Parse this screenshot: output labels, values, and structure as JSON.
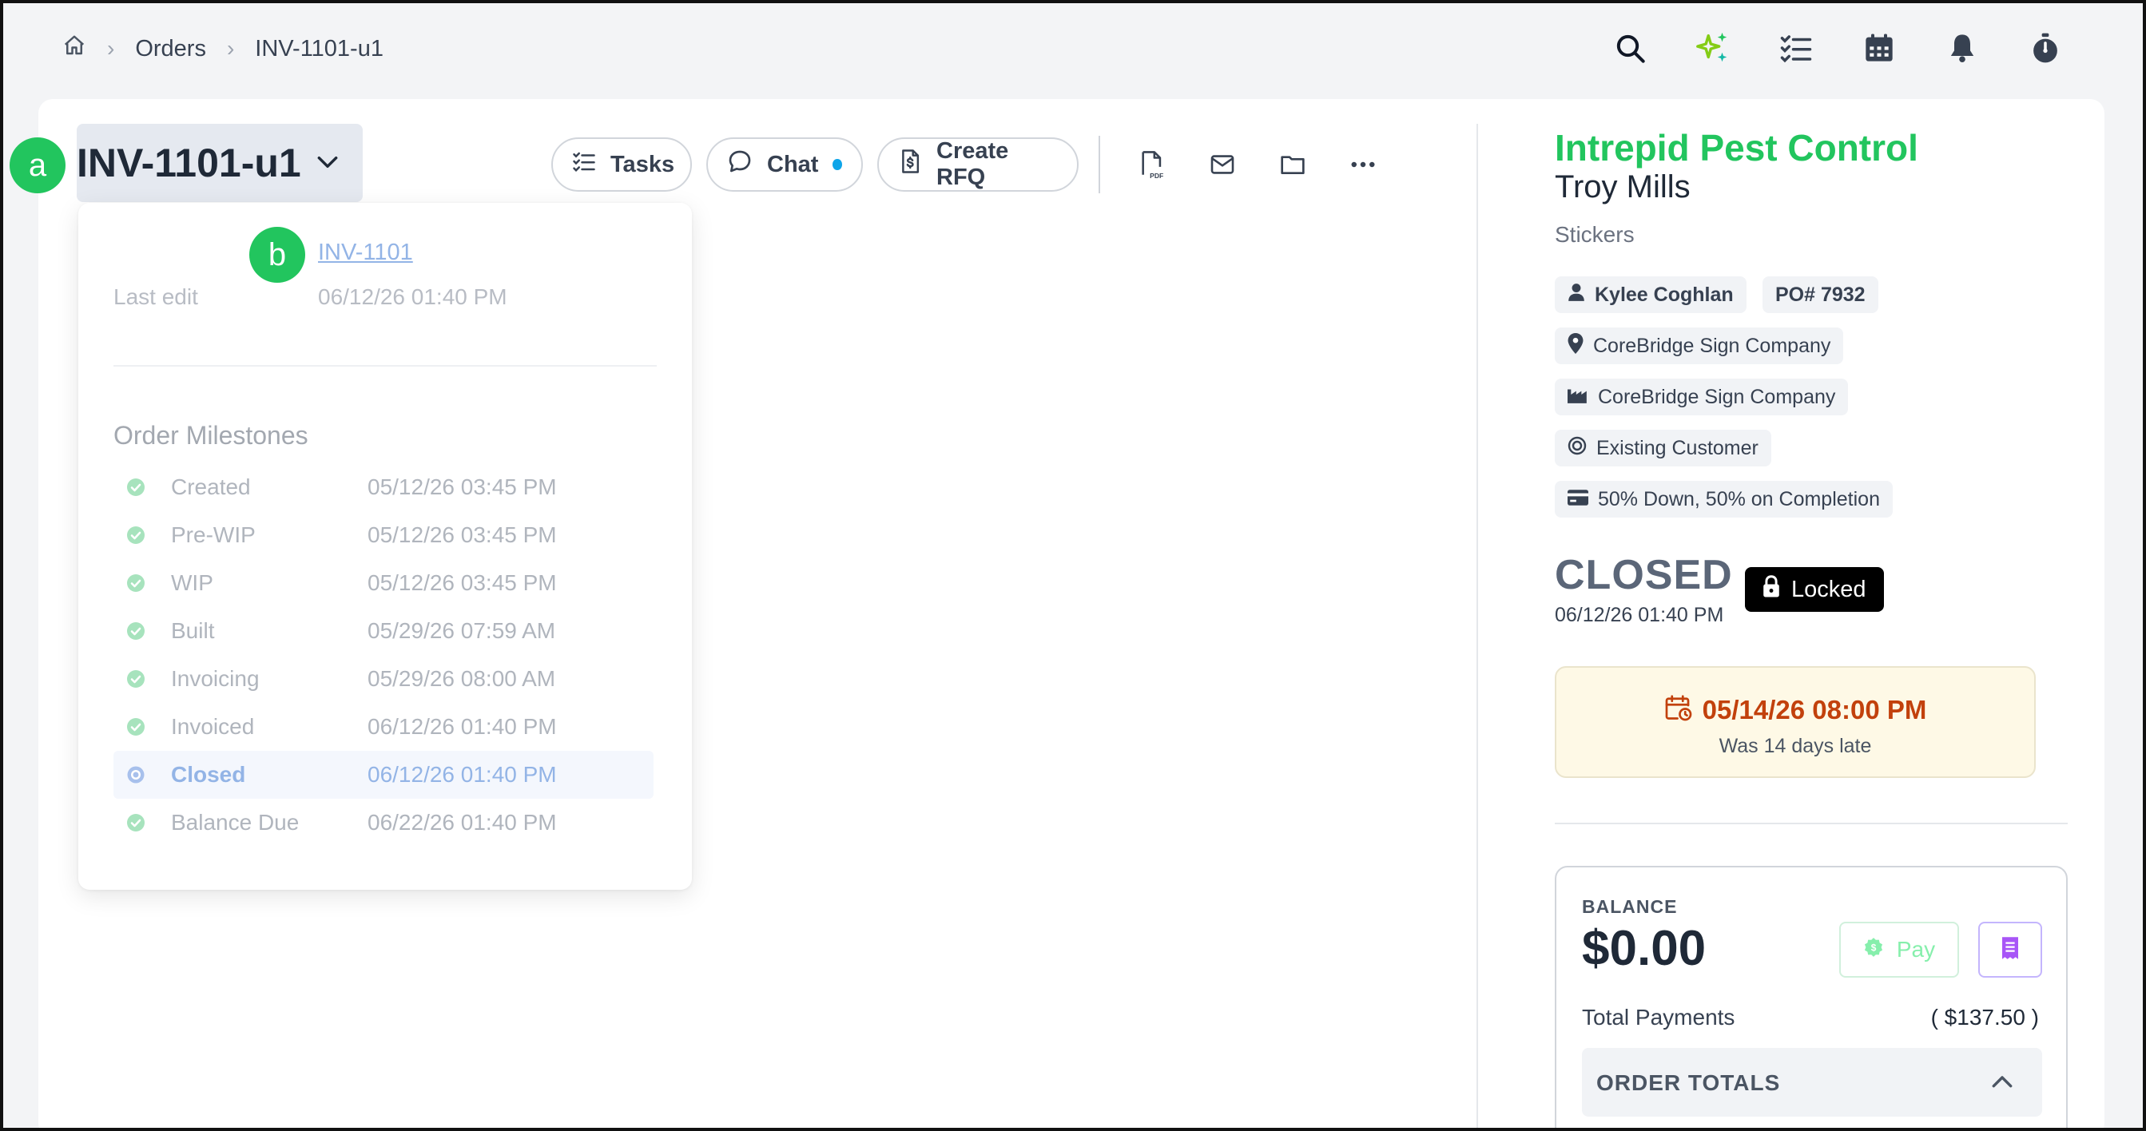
{
  "breadcrumb": {
    "home_icon": "home-icon",
    "items": [
      "Orders",
      "INV-1101-u1"
    ]
  },
  "top_icons": [
    "search-icon",
    "sparkles-icon",
    "checklist-icon",
    "calendar-icon",
    "bell-icon",
    "stopwatch-icon"
  ],
  "order": {
    "title": "INV-1101-u1",
    "badge_a": "a",
    "badge_b": "b"
  },
  "actions": {
    "tasks": "Tasks",
    "chat": "Chat",
    "create_rfq": "Create RFQ"
  },
  "toolbar_icons": [
    "pdf-icon",
    "mail-icon",
    "folder-icon",
    "more-icon"
  ],
  "popover": {
    "link": "INV-1101",
    "last_edit_label": "Last edit",
    "last_edit_value": "06/12/26 01:40 PM",
    "milestones_heading": "Order Milestones",
    "milestones": [
      {
        "name": "Created",
        "when": "05/12/26 03:45 PM"
      },
      {
        "name": "Pre-WIP",
        "when": "05/12/26 03:45 PM"
      },
      {
        "name": "WIP",
        "when": "05/12/26 03:45 PM"
      },
      {
        "name": "Built",
        "when": "05/29/26 07:59 AM"
      },
      {
        "name": "Invoicing",
        "when": "05/29/26 08:00 AM"
      },
      {
        "name": "Invoiced",
        "when": "06/12/26 01:40 PM"
      },
      {
        "name": "Closed",
        "when": "06/12/26 01:40 PM",
        "active": true
      },
      {
        "name": "Balance Due",
        "when": "06/22/26 01:40 PM"
      }
    ]
  },
  "customer": {
    "company": "Intrepid Pest Control",
    "contact": "Troy Mills",
    "product": "Stickers",
    "salesperson": "Kylee Coghlan",
    "po": "PO# 7932",
    "location": "CoreBridge Sign Company",
    "facility": "CoreBridge Sign Company",
    "customer_type": "Existing Customer",
    "payment_terms": "50% Down, 50% on Completion"
  },
  "status": {
    "label": "CLOSED",
    "date": "06/12/26 01:40 PM",
    "locked": "Locked"
  },
  "due": {
    "date": "05/14/26 08:00 PM",
    "note": "Was 14 days late"
  },
  "balance": {
    "label": "BALANCE",
    "value": "$0.00",
    "pay": "Pay",
    "total_payments_label": "Total Payments",
    "total_payments_value": "( $137.50 )",
    "order_totals": "ORDER TOTALS"
  },
  "colors": {
    "accent_green": "#22c55e",
    "due_orange": "#c2410c",
    "chat_dot": "#0ea5e9"
  }
}
